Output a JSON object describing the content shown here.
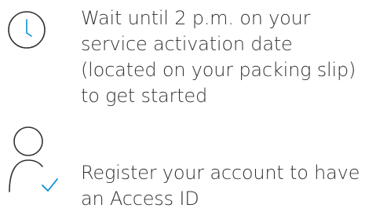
{
  "steps": [
    {
      "icon": "clock-icon",
      "text": "Wait until 2 p.m. on your service activation date (located on your packing slip) to get started"
    },
    {
      "icon": "user-check-icon",
      "text": "Register your account to have an Access ID"
    }
  ],
  "colors": {
    "icon_stroke": "#333333",
    "accent": "#0a8fd4",
    "text": "#333333"
  }
}
